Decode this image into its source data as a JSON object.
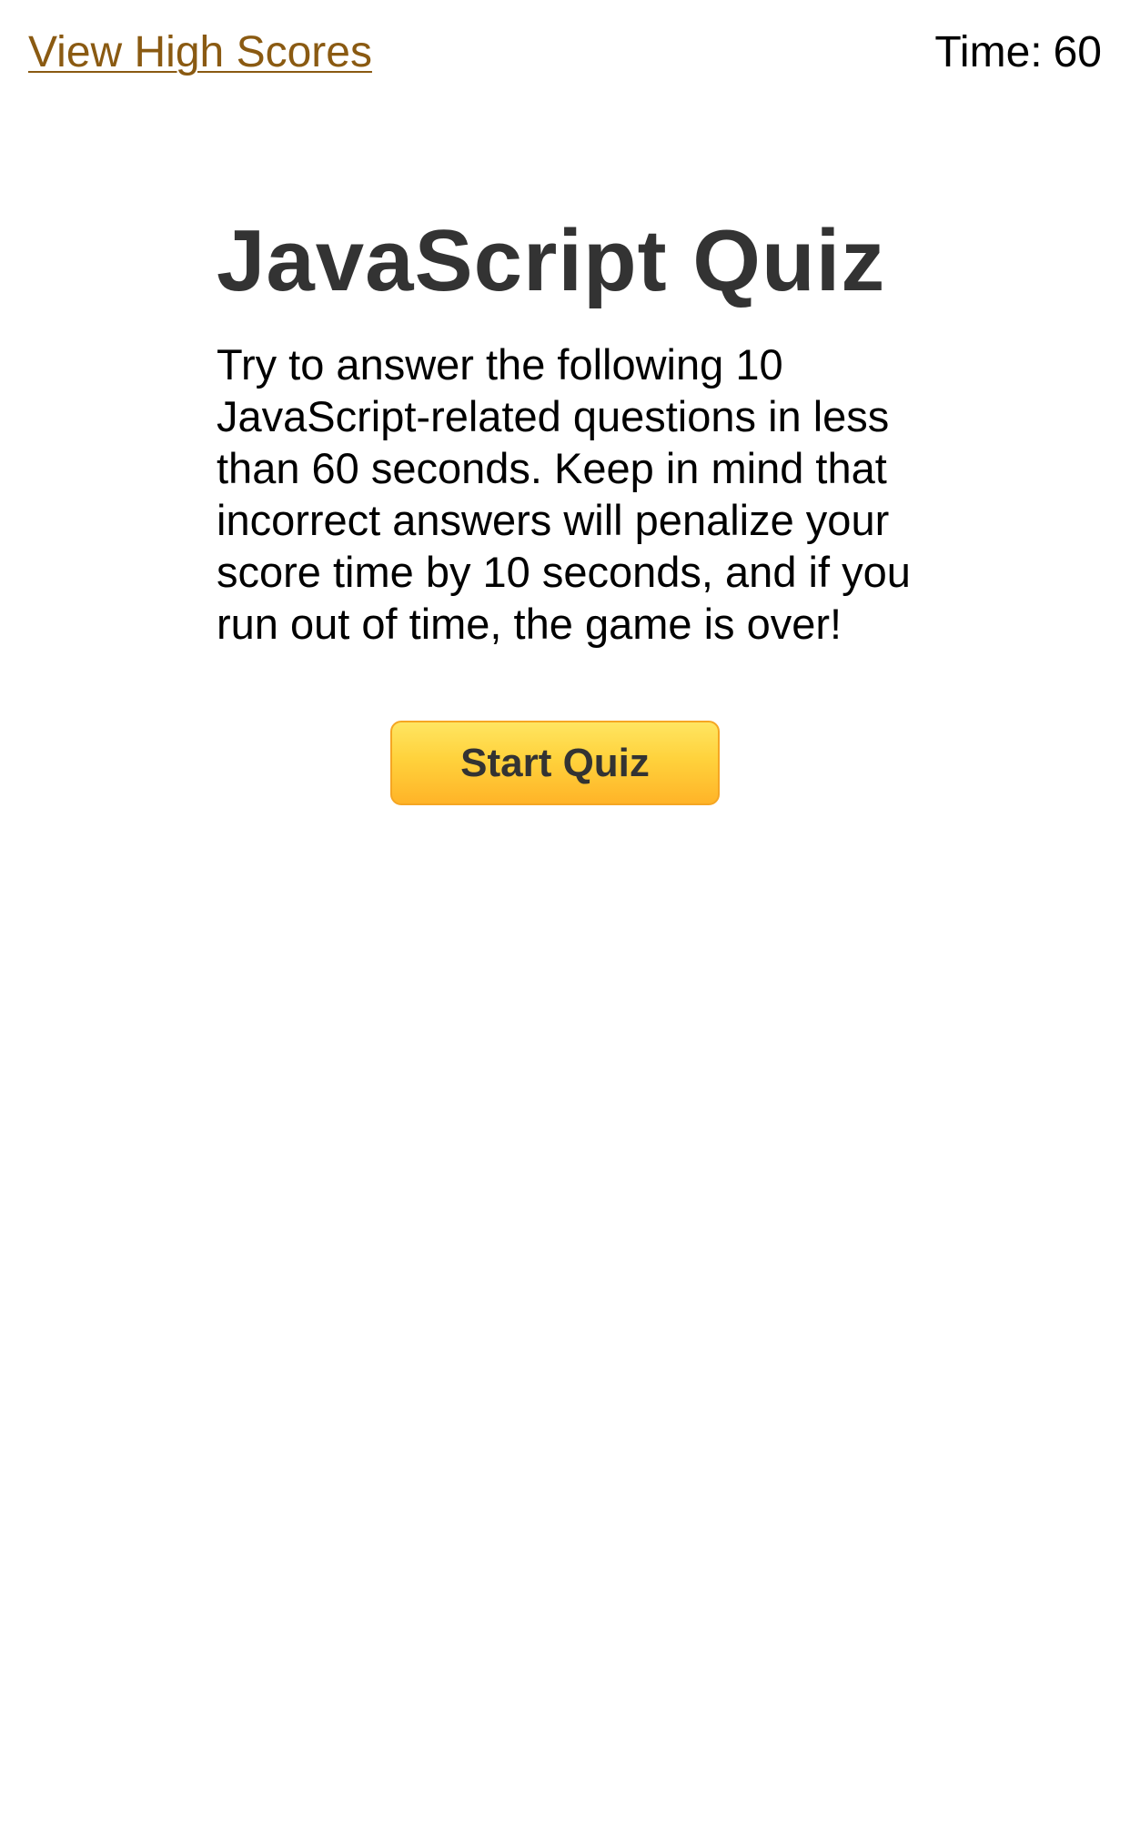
{
  "header": {
    "high_scores_link": "View High Scores",
    "timer_label": "Time:",
    "timer_value": "60"
  },
  "quiz": {
    "title": "JavaScript Quiz",
    "intro": "Try to answer the following 10 JavaScript-related questions in less than 60 seconds. Keep in mind that incorrect answers will penalize your score time by 10 seconds, and if you run out of time, the game is over!",
    "start_button": "Start Quiz"
  },
  "colors": {
    "link": "#8a5a12",
    "heading": "#333333",
    "button_top": "#ffe561",
    "button_bottom": "#ffb428",
    "button_border": "#f5a623"
  }
}
